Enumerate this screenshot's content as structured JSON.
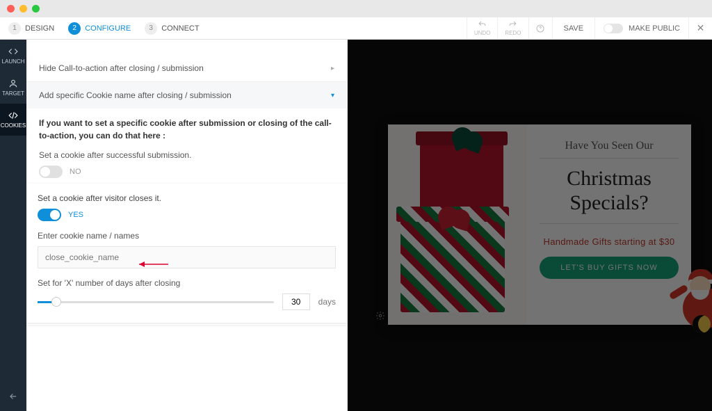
{
  "toolbar": {
    "steps": [
      {
        "num": "1",
        "label": "DESIGN"
      },
      {
        "num": "2",
        "label": "CONFIGURE"
      },
      {
        "num": "3",
        "label": "CONNECT"
      }
    ],
    "undo": "UNDO",
    "redo": "REDO",
    "save": "SAVE",
    "makePublic": "MAKE PUBLIC"
  },
  "sidebar": {
    "items": [
      {
        "label": "LAUNCH"
      },
      {
        "label": "TARGET"
      },
      {
        "label": "COOKIES"
      }
    ]
  },
  "panel": {
    "acc1": "Hide Call-to-action after closing / submission",
    "acc2": "Add specific Cookie name after closing / submission",
    "desc": "If you want to set a specific cookie after submission or closing of the call-to-action, you can do that here :",
    "opt1Label": "Set a cookie after successful submission.",
    "opt1Value": "NO",
    "opt2Label": "Set a cookie after visitor closes it.",
    "opt2Value": "YES",
    "cookieFieldLabel": "Enter cookie name / names",
    "cookiePlaceholder": "close_cookie_name",
    "daysLabel": "Set for 'X' number of days after closing",
    "daysValue": "30",
    "daysUnit": "days"
  },
  "preview": {
    "top": "Have You Seen Our",
    "mid1": "Christmas",
    "mid2": "Specials?",
    "sub": "Handmade Gifts starting at $30",
    "button": "LET'S BUY GIFTS NOW"
  }
}
